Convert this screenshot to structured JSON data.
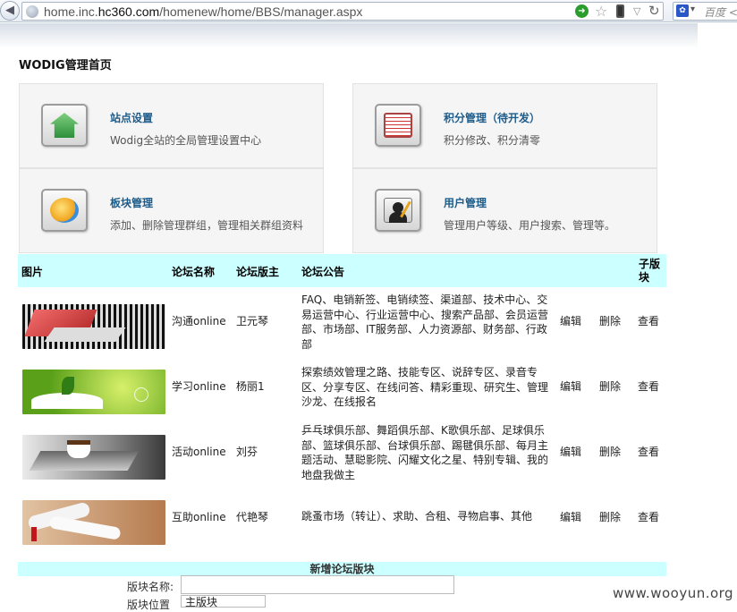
{
  "browser": {
    "url_prefix": "home.inc.",
    "url_domain": "hc360.com",
    "url_path": "/homenew/home/BBS/manager.aspx",
    "search_placeholder": "百度 <"
  },
  "page": {
    "title": "WODIG管理首页"
  },
  "panels": [
    {
      "title": "站点设置",
      "desc": "Wodig全站的全局管理设置中心",
      "icon": "home-icon"
    },
    {
      "title": "积分管理（待开发）",
      "desc": "积分修改、积分清零",
      "icon": "ledger-icon"
    },
    {
      "title": "板块管理",
      "desc": "添加、删除管理群组，管理相关群组资料",
      "icon": "refresh-arrows-icon"
    },
    {
      "title": "用户管理",
      "desc": "管理用户等级、用户搜索、管理等。",
      "icon": "user-admin-icon"
    }
  ],
  "table": {
    "headers": {
      "image": "图片",
      "name": "论坛名称",
      "owner": "论坛版主",
      "notice": "论坛公告",
      "sub": "子版块"
    },
    "rows": [
      {
        "name": "沟通online",
        "owner": "卫元琴",
        "notice": "FAQ、电销新签、电销续签、渠道部、技术中心、交易运营中心、行业运营中心、搜索产品部、会员运营部、市场部、IT服务部、人力资源部、财务部、行政部",
        "edit": "编辑",
        "delete": "删除",
        "view": "查看",
        "image": "laptop-image"
      },
      {
        "name": "学习online",
        "owner": "杨丽1",
        "notice": "探索绩效管理之路、技能专区、说辞专区、录音专区、分享专区、在线问答、精彩重现、研究生、管理沙龙、在线报名",
        "edit": "编辑",
        "delete": "删除",
        "view": "查看",
        "image": "book-sprout-image"
      },
      {
        "name": "活动online",
        "owner": "刘芬",
        "notice": "乒乓球俱乐部、舞蹈俱乐部、K歌俱乐部、足球俱乐部、篮球俱乐部、台球俱乐部、踢毽俱乐部、每月主题活动、慧聪影院、闪耀文化之星、特别专辑、我的地盘我做主",
        "edit": "编辑",
        "delete": "删除",
        "view": "查看",
        "image": "coffee-cup-image"
      },
      {
        "name": "互助online",
        "owner": "代艳琴",
        "notice": "跳蚤市场（转让）、求助、合租、寻物启事、其他",
        "edit": "编辑",
        "delete": "删除",
        "view": "查看",
        "image": "scrolls-image"
      }
    ]
  },
  "new_board": {
    "title": "新增论坛版块",
    "name_label": "版块名称:",
    "name_value": "",
    "position_label": "版块位置",
    "position_value": "主版块"
  },
  "watermark": "www.wooyun.org"
}
